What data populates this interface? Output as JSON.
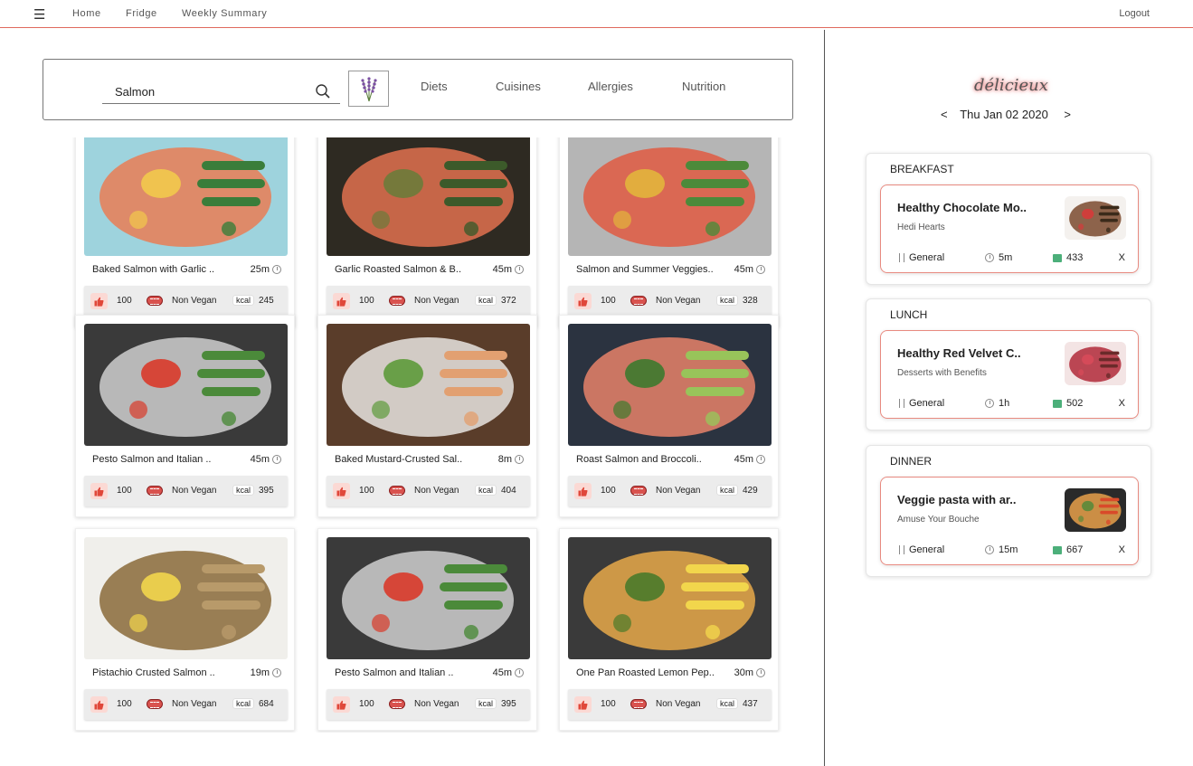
{
  "nav": {
    "links": [
      "Home",
      "Fridge",
      "Weekly Summary"
    ],
    "logout": "Logout"
  },
  "search": {
    "value": "Salmon",
    "filters": [
      "Diets",
      "Cuisines",
      "Allergies",
      "Nutrition"
    ]
  },
  "recipes": [
    {
      "name": "Baked Salmon with Garlic ..",
      "time": "25m",
      "likes": "100",
      "diet": "Non Vegan",
      "kcal_label": "kcal",
      "kcal": "245"
    },
    {
      "name": "Garlic Roasted Salmon & B..",
      "time": "45m",
      "likes": "100",
      "diet": "Non Vegan",
      "kcal_label": "kcal",
      "kcal": "372"
    },
    {
      "name": "Salmon and Summer Veggies..",
      "time": "45m",
      "likes": "100",
      "diet": "Non Vegan",
      "kcal_label": "kcal",
      "kcal": "328"
    },
    {
      "name": "Pesto Salmon and Italian ..",
      "time": "45m",
      "likes": "100",
      "diet": "Non Vegan",
      "kcal_label": "kcal",
      "kcal": "395"
    },
    {
      "name": "Baked Mustard-Crusted Sal..",
      "time": "8m",
      "likes": "100",
      "diet": "Non Vegan",
      "kcal_label": "kcal",
      "kcal": "404"
    },
    {
      "name": "Roast Salmon and Broccoli..",
      "time": "45m",
      "likes": "100",
      "diet": "Non Vegan",
      "kcal_label": "kcal",
      "kcal": "429"
    },
    {
      "name": "Pistachio Crusted Salmon ..",
      "time": "19m",
      "likes": "100",
      "diet": "Non Vegan",
      "kcal_label": "kcal",
      "kcal": "684"
    },
    {
      "name": "Pesto Salmon and Italian ..",
      "time": "45m",
      "likes": "100",
      "diet": "Non Vegan",
      "kcal_label": "kcal",
      "kcal": "395"
    },
    {
      "name": "One Pan Roasted Lemon Pep..",
      "time": "30m",
      "likes": "100",
      "diet": "Non Vegan",
      "kcal_label": "kcal",
      "kcal": "437"
    }
  ],
  "planner": {
    "logo": "délicieux",
    "prev": "<",
    "date": "Thu Jan 02 2020",
    "next": ">",
    "meals": [
      {
        "title": "BREAKFAST",
        "recipe": "Healthy Chocolate Mo..",
        "source": "Hedi Hearts",
        "category": "General",
        "time": "5m",
        "kcal": "433",
        "remove": "X"
      },
      {
        "title": "LUNCH",
        "recipe": "Healthy Red Velvet C..",
        "source": "Desserts with Benefits",
        "category": "General",
        "time": "1h",
        "kcal": "502",
        "remove": "X"
      },
      {
        "title": "DINNER",
        "recipe": "Veggie pasta with ar..",
        "source": "Amuse Your Bouche",
        "category": "General",
        "time": "15m",
        "kcal": "667",
        "remove": "X"
      }
    ]
  }
}
